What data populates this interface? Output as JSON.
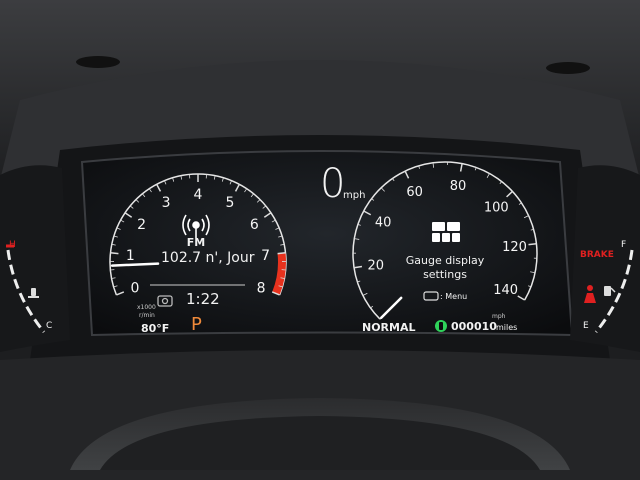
{
  "speed": {
    "value": "0",
    "unit": "mph"
  },
  "tachometer": {
    "ticks": [
      "0",
      "1",
      "2",
      "3",
      "4",
      "5",
      "6",
      "7",
      "8"
    ],
    "unit_line1": "x1000",
    "unit_line2": "r/min",
    "redline_start": 7,
    "redline_end": 8,
    "needle_value": 0.7
  },
  "speedometer": {
    "ticks": [
      "20",
      "40",
      "60",
      "80",
      "100",
      "120",
      "140"
    ],
    "unit": "mph",
    "needle_value": 0
  },
  "radio": {
    "band": "FM",
    "station": "102.7 n', Jour",
    "icon": "radio-broadcast-icon"
  },
  "clock": "1:22",
  "outside_temp": "80°F",
  "gear": "P",
  "gauge_menu": {
    "title_line1": "Gauge display",
    "title_line2": "settings",
    "menu_label": ": Menu",
    "icon": "gauge-layout-icon"
  },
  "drive_mode": "NORMAL",
  "odometer": "000010",
  "odometer_unit": "miles",
  "indicators": {
    "brake": "BRAKE",
    "temp_hot": "H",
    "temp_cold": "C",
    "fuel_full": "F",
    "fuel_empty": "E"
  },
  "colors": {
    "redline": "#e8321e",
    "gear_p": "#f08a3a",
    "eco": "#2fd35a",
    "brake": "#e02020",
    "seatbelt": "#e02020"
  }
}
